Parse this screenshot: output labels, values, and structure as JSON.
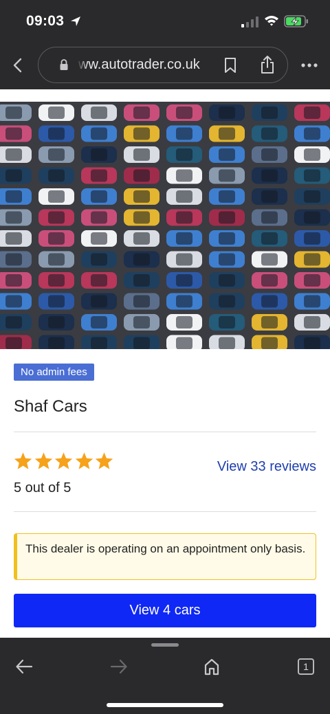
{
  "status_bar": {
    "time": "09:03"
  },
  "browser": {
    "url": "ww.autotrader.co.uk"
  },
  "dealer": {
    "badge": "No admin fees",
    "name": "Shaf Cars",
    "rating_text": "5 out of 5",
    "rating_value": 5,
    "rating_max": 5,
    "reviews_link": "View 33 reviews",
    "notice": "This dealer is operating on an appointment only basis.",
    "view_cars_button": "View 4 cars"
  },
  "toolbar": {
    "tab_count": "1"
  },
  "colors": {
    "badge_bg": "#4a6ed4",
    "link": "#1e3fae",
    "button_bg": "#0f28f5",
    "star": "#f6a21a",
    "notice_border": "#f0c020",
    "chrome_bg": "#2a2a2c"
  },
  "icons": [
    "location-arrow-icon",
    "signal-icon",
    "wifi-icon",
    "battery-charging-icon",
    "back-chevron-icon",
    "lock-icon",
    "bookmark-icon",
    "share-icon",
    "more-icon",
    "arrow-left-icon",
    "arrow-right-icon",
    "home-icon",
    "tabs-icon"
  ]
}
